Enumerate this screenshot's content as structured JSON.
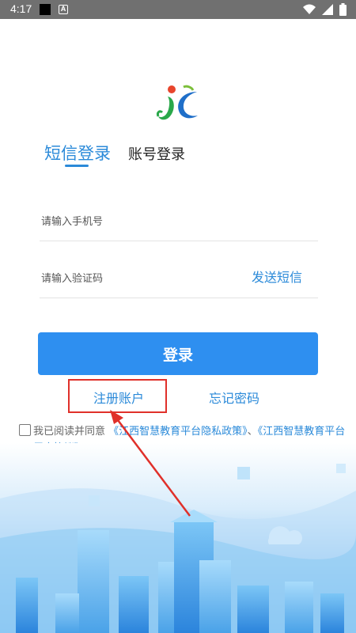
{
  "status_bar": {
    "time": "4:17",
    "icons": [
      "wifi-icon",
      "signal-icon",
      "battery-icon"
    ]
  },
  "logo": {
    "icon": "jc-logo-icon"
  },
  "tabs": [
    {
      "label": "短信登录",
      "active": true
    },
    {
      "label": "账号登录",
      "active": false
    }
  ],
  "form": {
    "phone_placeholder": "请输入手机号",
    "code_placeholder": "请输入验证码",
    "send_sms_label": "发送短信"
  },
  "login_button": {
    "label": "登录"
  },
  "links": {
    "register": "注册账户",
    "forget_password": "忘记密码"
  },
  "agreement": {
    "prefix": "我已阅读并同意",
    "privacy_link": "《江西智慧教育平台隐私政策》",
    "separator": "、",
    "user_link": "《江西智慧教育平台用户协议》",
    "checked": false
  },
  "colors": {
    "accent": "#2b8ad9",
    "button": "#2e8ff0",
    "annotation": "#e0302a",
    "status_bar": "#707070"
  }
}
